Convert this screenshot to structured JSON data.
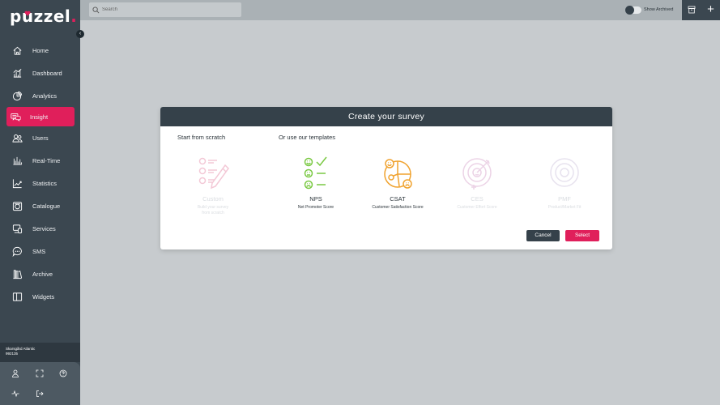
{
  "app": {
    "logo_text_pre": "p",
    "logo_text_post": "zzel",
    "logo_dot": ".",
    "colors": {
      "brand": "#e01f5b",
      "sidebar": "#3b4750",
      "modal_header": "#35414a",
      "csat": "#f0a22e",
      "nps": "#7ac943",
      "disabled": "#f3c8d6"
    }
  },
  "sidebar": {
    "items": [
      {
        "label": "Home",
        "icon": "home-icon"
      },
      {
        "label": "Dashboard",
        "icon": "dashboard-icon"
      },
      {
        "label": "Analytics",
        "icon": "analytics-icon"
      },
      {
        "label": "Insight",
        "icon": "insight-icon",
        "active": true
      },
      {
        "label": "Users",
        "icon": "users-icon"
      },
      {
        "label": "Real-Time",
        "icon": "realtime-icon"
      },
      {
        "label": "Statistics",
        "icon": "statistics-icon"
      },
      {
        "label": "Catalogue",
        "icon": "catalogue-icon"
      },
      {
        "label": "Services",
        "icon": "services-icon"
      },
      {
        "label": "SMS",
        "icon": "sms-icon"
      },
      {
        "label": "Archive",
        "icon": "archive-icon"
      },
      {
        "label": "Widgets",
        "icon": "widgets-icon"
      }
    ],
    "company_name": "Skarsgård Atlantic",
    "company_id": "992135"
  },
  "topbar": {
    "search_placeholder": "Search",
    "show_archived_label": "Show Archived",
    "add_label": "+"
  },
  "modal": {
    "title": "Create your survey",
    "scratch_label": "Start from scratch",
    "templates_label": "Or use our templates",
    "templates": [
      {
        "title": "Custom",
        "subtitle_line1": "Build your survey",
        "subtitle_line2": "from scratch",
        "enabled": false
      },
      {
        "title": "NPS",
        "subtitle_line1": "Net Promoter Score",
        "subtitle_line2": "",
        "enabled": true
      },
      {
        "title": "CSAT",
        "subtitle_line1": "Customer Satisfaction Score",
        "subtitle_line2": "",
        "enabled": true
      },
      {
        "title": "CES",
        "subtitle_line1": "Customer Effort Score",
        "subtitle_line2": "",
        "enabled": false
      },
      {
        "title": "PMF",
        "subtitle_line1": "Product/Market Fit",
        "subtitle_line2": "",
        "enabled": false
      }
    ],
    "cancel_label": "Cancel",
    "select_label": "Select"
  }
}
